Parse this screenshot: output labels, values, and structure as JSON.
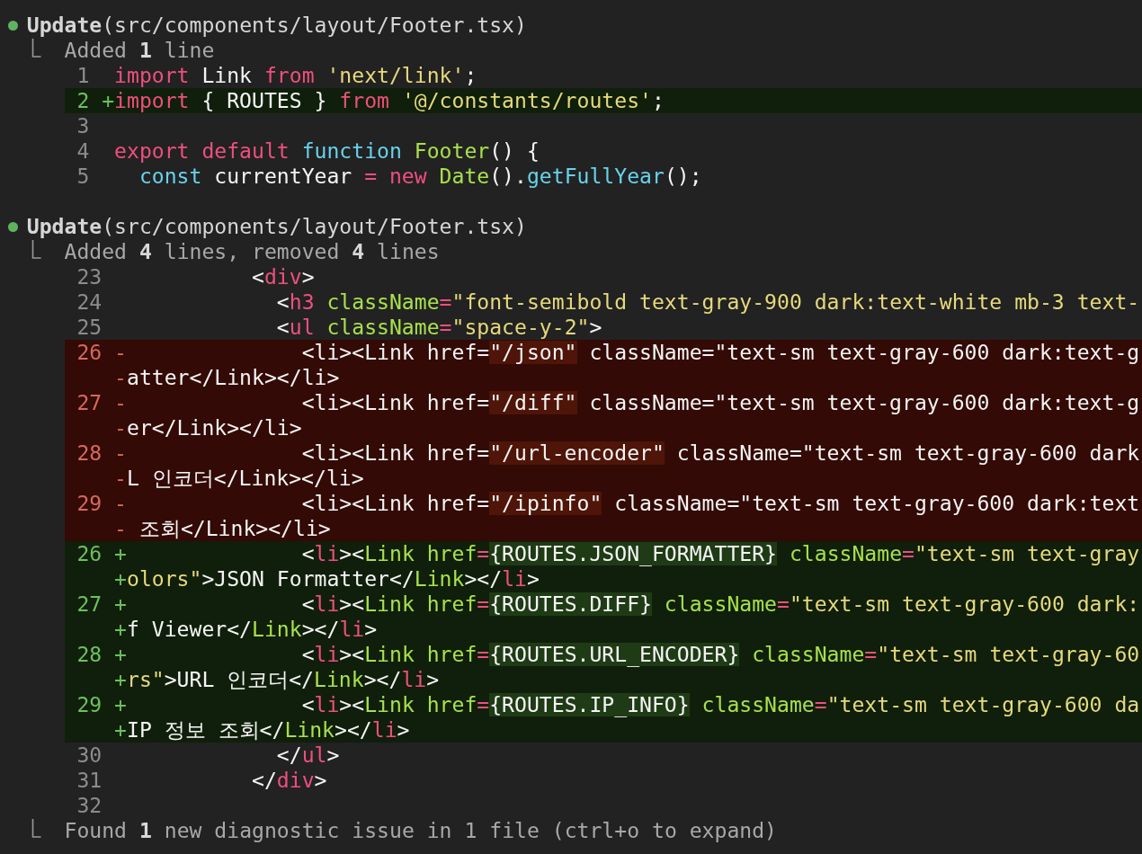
{
  "blocks": [
    {
      "color": "#5fb35f",
      "header": "**Update**(src/components/layout/Footer.tsx)",
      "summary": "Added **1** line",
      "lines": [
        {
          "number": "1",
          "kind": "context",
          "tokens": [
            {
              "t": "import",
              "kind": "kw"
            },
            {
              "t": " Link "
            },
            {
              "t": "from ",
              "kind": "kw"
            },
            {
              "t": "'next/link'",
              "kind": "str"
            },
            {
              "t": ";"
            }
          ]
        },
        {
          "number": "2",
          "kind": "added",
          "marker": "+",
          "tokens": [
            {
              "t": "import",
              "kind": "kw"
            },
            {
              "t": " { ROUTES } "
            },
            {
              "t": "from ",
              "kind": "kw"
            },
            {
              "t": "'@/constants/routes'",
              "kind": "str"
            },
            {
              "t": ";"
            }
          ]
        },
        {
          "number": "3",
          "kind": "context"
        },
        {
          "number": "4",
          "kind": "context",
          "tokens": [
            {
              "t": "export default ",
              "kind": "kw"
            },
            {
              "t": "function ",
              "kind": "type"
            },
            {
              "t": "Footer",
              "kind": "fn"
            },
            {
              "t": "() {"
            }
          ]
        },
        {
          "number": "5",
          "kind": "context",
          "tokens": [
            {
              "t": "  const",
              "kind": "type"
            },
            {
              "t": " currentYear "
            },
            {
              "t": "= new ",
              "kind": "kw"
            },
            {
              "t": "Date",
              "kind": "fn"
            },
            {
              "t": "()."
            },
            {
              "t": "getFullYear",
              "kind": "type"
            },
            {
              "t": "();"
            }
          ]
        }
      ]
    },
    {
      "color": "#5fb35f",
      "header": "**Update**(src/components/layout/Footer.tsx)",
      "summary": "Added **4** lines, removed **4** lines",
      "lines": [
        {
          "number": "23",
          "kind": "context",
          "tokens": [
            {
              "t": "          <"
            },
            {
              "t": "div",
              "kind": "kw"
            },
            {
              "t": ">"
            }
          ]
        },
        {
          "number": "24",
          "kind": "context",
          "tokens": [
            {
              "t": "            <"
            },
            {
              "t": "h3 ",
              "kind": "kw"
            },
            {
              "t": "className",
              "kind": "fn"
            },
            {
              "t": "=",
              "kind": "kw"
            },
            {
              "t": "\"font-semibold text-gray-900 dark:text-white mb-3 text-",
              "kind": "str"
            }
          ]
        },
        {
          "number": "25",
          "kind": "context",
          "tokens": [
            {
              "t": "            <"
            },
            {
              "t": "ul ",
              "kind": "kw"
            },
            {
              "t": "className",
              "kind": "fn"
            },
            {
              "t": "=",
              "kind": "kw"
            },
            {
              "t": "\"space-y-2\"",
              "kind": "str"
            },
            {
              "t": ">"
            }
          ]
        },
        {
          "number": "26",
          "kind": "removed",
          "marker": "-",
          "tokens": [
            {
              "t": "              <li><Link href="
            },
            {
              "t": "\"/json\"",
              "hl": true
            },
            {
              "t": " className=\"text-sm text-gray-600 dark:text-g"
            }
          ],
          "continuation": {
            "marker": "-",
            "tokens": [
              {
                "t": "atter</Link></li>"
              }
            ]
          }
        },
        {
          "number": "27",
          "kind": "removed",
          "marker": "-",
          "tokens": [
            {
              "t": "              <li><Link href="
            },
            {
              "t": "\"/diff\"",
              "hl": true
            },
            {
              "t": " className=\"text-sm text-gray-600 dark:text-g"
            }
          ],
          "continuation": {
            "marker": "-",
            "tokens": [
              {
                "t": "er</Link></li>"
              }
            ]
          }
        },
        {
          "number": "28",
          "kind": "removed",
          "marker": "-",
          "tokens": [
            {
              "t": "              <li><Link href="
            },
            {
              "t": "\"/url-encoder\"",
              "hl": true
            },
            {
              "t": " className=\"text-sm text-gray-600 dark"
            }
          ],
          "continuation": {
            "marker": "-",
            "tokens": [
              {
                "t": "L 인코더</Link></li>"
              }
            ]
          }
        },
        {
          "number": "29",
          "kind": "removed",
          "marker": "-",
          "tokens": [
            {
              "t": "              <li><Link href="
            },
            {
              "t": "\"/ipinfo\"",
              "hl": true
            },
            {
              "t": " className=\"text-sm text-gray-600 dark:text"
            }
          ],
          "continuation": {
            "marker": "-",
            "tokens": [
              {
                "t": " 조회</Link></li>"
              }
            ]
          }
        },
        {
          "number": "26",
          "kind": "added",
          "marker": "+",
          "tokens": [
            {
              "t": "              <"
            },
            {
              "t": "li",
              "kind": "kw"
            },
            {
              "t": "><"
            },
            {
              "t": "Link href",
              "kind": "fn"
            },
            {
              "t": "=",
              "kind": "kw"
            },
            {
              "t": "{ROUTES.JSON_FORMATTER}",
              "hl": true
            },
            {
              "t": " className",
              "kind": "fn"
            },
            {
              "t": "=",
              "kind": "kw"
            },
            {
              "t": "\"text-sm text-gray",
              "kind": "str"
            }
          ],
          "continuation": {
            "marker": "+",
            "tokens": [
              {
                "t": "olors\"",
                "kind": "str"
              },
              {
                "t": ">JSON Formatter</"
              },
              {
                "t": "Link",
                "kind": "fn"
              },
              {
                "t": "></"
              },
              {
                "t": "li",
                "kind": "kw"
              },
              {
                "t": ">"
              }
            ]
          }
        },
        {
          "number": "27",
          "kind": "added",
          "marker": "+",
          "tokens": [
            {
              "t": "              <"
            },
            {
              "t": "li",
              "kind": "kw"
            },
            {
              "t": "><"
            },
            {
              "t": "Link href",
              "kind": "fn"
            },
            {
              "t": "=",
              "kind": "kw"
            },
            {
              "t": "{ROUTES.DIFF}",
              "hl": true
            },
            {
              "t": " className",
              "kind": "fn"
            },
            {
              "t": "=",
              "kind": "kw"
            },
            {
              "t": "\"text-sm text-gray-600 dark:",
              "kind": "str"
            }
          ],
          "continuation": {
            "marker": "+",
            "tokens": [
              {
                "t": "f Viewer</"
              },
              {
                "t": "Link",
                "kind": "fn"
              },
              {
                "t": "></"
              },
              {
                "t": "li",
                "kind": "kw"
              },
              {
                "t": ">"
              }
            ]
          }
        },
        {
          "number": "28",
          "kind": "added",
          "marker": "+",
          "tokens": [
            {
              "t": "              <"
            },
            {
              "t": "li",
              "kind": "kw"
            },
            {
              "t": "><"
            },
            {
              "t": "Link href",
              "kind": "fn"
            },
            {
              "t": "=",
              "kind": "kw"
            },
            {
              "t": "{ROUTES.URL_ENCODER}",
              "hl": true
            },
            {
              "t": " className",
              "kind": "fn"
            },
            {
              "t": "=",
              "kind": "kw"
            },
            {
              "t": "\"text-sm text-gray-60",
              "kind": "str"
            }
          ],
          "continuation": {
            "marker": "+",
            "tokens": [
              {
                "t": "rs\"",
                "kind": "str"
              },
              {
                "t": ">URL 인코더</"
              },
              {
                "t": "Link",
                "kind": "fn"
              },
              {
                "t": "></"
              },
              {
                "t": "li",
                "kind": "kw"
              },
              {
                "t": ">"
              }
            ]
          }
        },
        {
          "number": "29",
          "kind": "added",
          "marker": "+",
          "tokens": [
            {
              "t": "              <"
            },
            {
              "t": "li",
              "kind": "kw"
            },
            {
              "t": "><"
            },
            {
              "t": "Link href",
              "kind": "fn"
            },
            {
              "t": "=",
              "kind": "kw"
            },
            {
              "t": "{ROUTES.IP_INFO}",
              "hl": true
            },
            {
              "t": " className",
              "kind": "fn"
            },
            {
              "t": "=",
              "kind": "kw"
            },
            {
              "t": "\"text-sm text-gray-600 da",
              "kind": "str"
            }
          ],
          "continuation": {
            "marker": "+",
            "tokens": [
              {
                "t": "IP 정보 조회</"
              },
              {
                "t": "Link",
                "kind": "fn"
              },
              {
                "t": "></"
              },
              {
                "t": "li",
                "kind": "kw"
              },
              {
                "t": ">"
              }
            ]
          }
        },
        {
          "number": "30",
          "kind": "context",
          "tokens": [
            {
              "t": "            </"
            },
            {
              "t": "ul",
              "kind": "kw"
            },
            {
              "t": ">"
            }
          ]
        },
        {
          "number": "31",
          "kind": "context",
          "tokens": [
            {
              "t": "          </"
            },
            {
              "t": "div",
              "kind": "kw"
            },
            {
              "t": ">"
            }
          ]
        },
        {
          "number": "32",
          "kind": "context"
        }
      ],
      "note": "Found **1** new diagnostic issue in 1 file (ctrl+o to expand)"
    }
  ]
}
